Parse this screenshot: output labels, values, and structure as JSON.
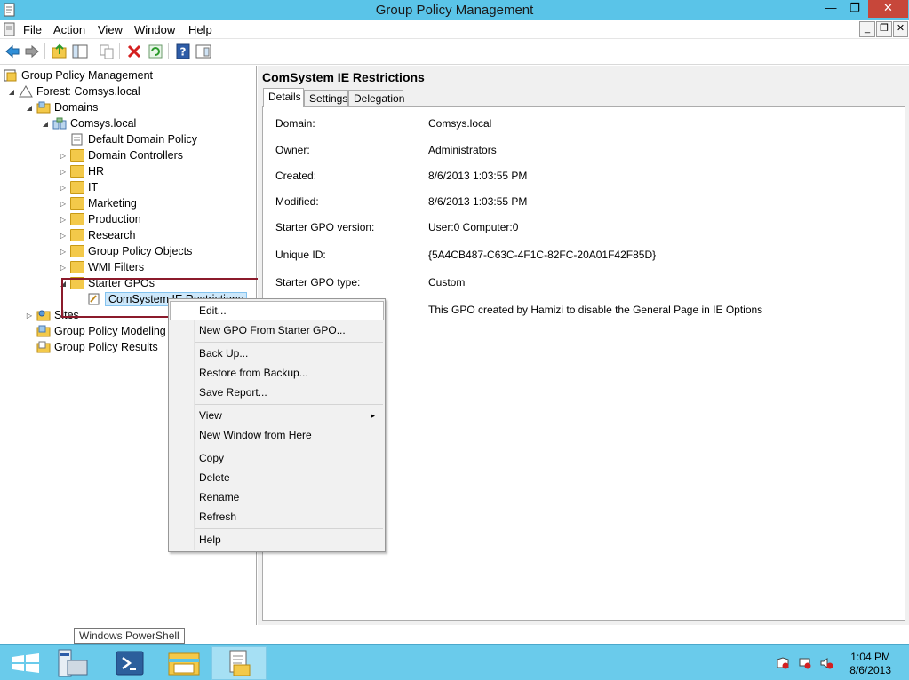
{
  "window": {
    "title": "Group Policy Management",
    "controls": {
      "minimize": "—",
      "maximize": "❐",
      "close": "✕"
    }
  },
  "menubar": {
    "items": [
      "File",
      "Action",
      "View",
      "Window",
      "Help"
    ],
    "mdi": {
      "minimize": "_",
      "restore": "❐",
      "close": "✕"
    }
  },
  "toolbar": {
    "buttons": [
      "back-icon",
      "forward-icon",
      "up-folder-icon",
      "show-hide-tree-icon",
      "copy-icon",
      "delete-icon",
      "refresh-icon",
      "help-icon",
      "properties-icon"
    ]
  },
  "tree": {
    "root": "Group Policy Management",
    "forest": "Forest: Comsys.local",
    "domains": "Domains",
    "domain": "Comsys.local",
    "children": [
      "Default Domain Policy",
      "Domain Controllers",
      "HR",
      "IT",
      "Marketing",
      "Production",
      "Research",
      "Group Policy Objects",
      "WMI Filters",
      "Starter GPOs"
    ],
    "starter_child": "ComSystem IE Restrictions",
    "sites": "Sites",
    "modeling": "Group Policy Modeling",
    "results": "Group Policy Results"
  },
  "details": {
    "heading": "ComSystem IE Restrictions",
    "tabs": [
      "Details",
      "Settings",
      "Delegation"
    ],
    "active_tab": "Details",
    "fields": [
      {
        "label": "Domain:",
        "value": "Comsys.local"
      },
      {
        "label": "Owner:",
        "value": "Administrators"
      },
      {
        "label": "Created:",
        "value": "8/6/2013 1:03:55 PM"
      },
      {
        "label": "Modified:",
        "value": "8/6/2013 1:03:55 PM"
      },
      {
        "label": "Starter GPO version:",
        "value": "User:0 Computer:0"
      },
      {
        "label": "Unique ID:",
        "value": "{5A4CB487-C63C-4F1C-82FC-20A01F42F85D}"
      },
      {
        "label": "Starter GPO type:",
        "value": "Custom"
      },
      {
        "label": "",
        "value": "This GPO created by Hamizi to disable the General Page in IE Options"
      }
    ]
  },
  "context_menu": {
    "items": [
      "Edit...",
      "New GPO From Starter GPO...",
      "Back Up...",
      "Restore from Backup...",
      "Save Report...",
      "View",
      "New Window from Here",
      "Copy",
      "Delete",
      "Rename",
      "Refresh",
      "Help"
    ],
    "submenu_arrow": "▸",
    "hovered": "Edit..."
  },
  "tooltip": "Windows PowerShell",
  "taskbar": {
    "apps": [
      "start-icon",
      "server-manager-icon",
      "powershell-icon",
      "file-explorer-icon",
      "group-policy-management-icon"
    ],
    "clock": {
      "time": "1:04 PM",
      "date": "8/6/2013"
    }
  },
  "colors": {
    "titlebar": "#5ac4e8",
    "close_button": "#c7473a",
    "taskbar": "#6acbeb",
    "selection": "#cde8fb",
    "annotation_box": "#8b1a2b"
  }
}
